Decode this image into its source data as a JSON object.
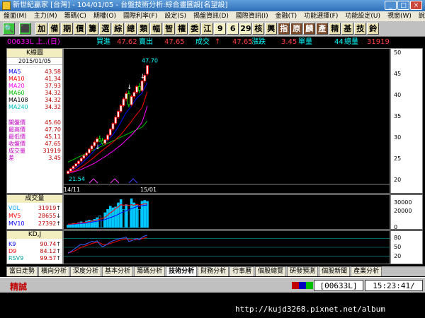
{
  "window": {
    "title": "新世紀贏家 [台灣] - 104/01/05 - 台盤技術分析:綜合畫圖設[名望設]",
    "btn_min": "_",
    "btn_max": "□",
    "btn_close": "×"
  },
  "menu": [
    "盤面(M)",
    "主力(M)",
    "籌碼(C)",
    "期權(O)",
    "國際利率(F)",
    "設定(S)",
    "揭盤資訊(D)",
    "國際資訊(I)",
    "金融(T)",
    "功能選擇(F)",
    "功能設定(U)",
    "視窗(W)",
    "說明(H)"
  ],
  "toolbar": {
    "green_icon_1": "🔍",
    "green_icon_2": "⬛",
    "buttons": [
      "加",
      "備",
      "期",
      "價",
      "籌",
      "選",
      "綜",
      "總",
      "類",
      "幅",
      "智",
      "權",
      "委",
      "江",
      "9",
      "6",
      "29",
      "核",
      "興",
      "指",
      "原",
      "麟",
      "產",
      "精",
      "基",
      "技",
      "鈴"
    ]
  },
  "quote": {
    "code": "00633L 上..(日)",
    "bid_label": "買進",
    "bid": "47.62",
    "ask_label": "賣出",
    "ask": "47.65",
    "last_label": "成交",
    "arrow": "↑",
    "change_label": "漲跌",
    "change": "47.65",
    "unit_label": "單量",
    "unit": "3.45",
    "total_label": "總量",
    "total_pre": "44",
    "total": "31919"
  },
  "left_panel": {
    "title": "K線圖",
    "date": "2015/01/05",
    "ma": [
      {
        "label": "MA5",
        "value": "43.58",
        "color": "#0000ff"
      },
      {
        "label": "MA10",
        "value": "41.34",
        "color": "#ff0000"
      },
      {
        "label": "MA20",
        "value": "37.93",
        "color": "#ff00ff"
      },
      {
        "label": "MA60",
        "value": "34.32",
        "color": "#00c000"
      },
      {
        "label": "MA108",
        "value": "34.32",
        "color": "#000000"
      },
      {
        "label": "MA240",
        "value": "34.32",
        "color": "#00c0c0"
      }
    ],
    "ohlc": [
      {
        "label": "開盤價",
        "value": "45.60"
      },
      {
        "label": "最高價",
        "value": "47.70"
      },
      {
        "label": "最低價",
        "value": "45.11"
      },
      {
        "label": "收盤價",
        "value": "47.65"
      },
      {
        "label": "成交量",
        "value": "31919"
      },
      {
        "label": "差",
        "value": "3.45"
      }
    ]
  },
  "main_chart": {
    "high_label": "47.70",
    "low_label": "21.54",
    "date_start": "14/11",
    "date_end": "15/01",
    "yticks": [
      "50",
      "45",
      "40",
      "35",
      "30",
      "25",
      "20"
    ],
    "ylim": [
      19,
      51
    ],
    "candles": [
      {
        "o": 21.6,
        "h": 22.4,
        "l": 21.54,
        "c": 22.2
      },
      {
        "o": 22.2,
        "h": 23.0,
        "l": 21.9,
        "c": 22.8
      },
      {
        "o": 22.8,
        "h": 23.6,
        "l": 22.5,
        "c": 23.4
      },
      {
        "o": 23.4,
        "h": 24.2,
        "l": 23.0,
        "c": 24.0
      },
      {
        "o": 24.0,
        "h": 24.9,
        "l": 23.7,
        "c": 24.6
      },
      {
        "o": 24.6,
        "h": 25.6,
        "l": 24.3,
        "c": 25.3
      },
      {
        "o": 25.3,
        "h": 26.2,
        "l": 25.0,
        "c": 26.0
      },
      {
        "o": 26.0,
        "h": 26.9,
        "l": 25.6,
        "c": 26.6
      },
      {
        "o": 26.6,
        "h": 27.8,
        "l": 26.3,
        "c": 27.5
      },
      {
        "o": 27.5,
        "h": 28.6,
        "l": 27.1,
        "c": 28.3
      },
      {
        "o": 28.3,
        "h": 29.6,
        "l": 27.9,
        "c": 29.2
      },
      {
        "o": 29.2,
        "h": 30.4,
        "l": 28.8,
        "c": 30.0
      },
      {
        "o": 30.0,
        "h": 30.8,
        "l": 29.2,
        "c": 29.5
      },
      {
        "o": 29.5,
        "h": 30.2,
        "l": 28.6,
        "c": 28.9
      },
      {
        "o": 28.9,
        "h": 30.1,
        "l": 28.5,
        "c": 29.8
      },
      {
        "o": 29.8,
        "h": 31.2,
        "l": 29.4,
        "c": 30.9
      },
      {
        "o": 30.9,
        "h": 32.6,
        "l": 30.5,
        "c": 32.3
      },
      {
        "o": 32.3,
        "h": 34.0,
        "l": 31.9,
        "c": 33.7
      },
      {
        "o": 33.7,
        "h": 35.6,
        "l": 33.3,
        "c": 35.2
      },
      {
        "o": 35.2,
        "h": 37.0,
        "l": 34.8,
        "c": 36.6
      },
      {
        "o": 36.6,
        "h": 38.4,
        "l": 36.2,
        "c": 38.0
      },
      {
        "o": 38.0,
        "h": 40.0,
        "l": 37.6,
        "c": 39.6
      },
      {
        "o": 39.6,
        "h": 41.4,
        "l": 39.0,
        "c": 40.9
      },
      {
        "o": 40.9,
        "h": 41.6,
        "l": 37.6,
        "c": 38.2
      },
      {
        "o": 38.2,
        "h": 40.6,
        "l": 37.8,
        "c": 40.2
      },
      {
        "o": 40.2,
        "h": 41.6,
        "l": 39.7,
        "c": 41.2
      },
      {
        "o": 41.2,
        "h": 43.0,
        "l": 40.8,
        "c": 42.6
      },
      {
        "o": 42.6,
        "h": 43.4,
        "l": 41.0,
        "c": 41.6
      },
      {
        "o": 41.6,
        "h": 44.2,
        "l": 41.3,
        "c": 43.9
      },
      {
        "o": 43.9,
        "h": 45.8,
        "l": 43.5,
        "c": 45.3
      },
      {
        "o": 45.6,
        "h": 47.7,
        "l": 45.11,
        "c": 47.65
      }
    ],
    "ma5": [
      21.8,
      22.2,
      22.6,
      23.0,
      23.5,
      24.0,
      24.6,
      25.2,
      25.8,
      26.5,
      27.2,
      27.9,
      28.5,
      28.9,
      29.3,
      29.8,
      30.3,
      31.0,
      31.9,
      32.9,
      34.0,
      35.2,
      36.3,
      37.1,
      37.9,
      38.9,
      39.8,
      40.4,
      41.0,
      42.3,
      43.58
    ],
    "ma10": [
      21.8,
      22.0,
      22.2,
      22.5,
      22.8,
      23.2,
      23.6,
      24.1,
      24.6,
      25.1,
      25.6,
      26.2,
      26.7,
      27.2,
      27.7,
      28.2,
      28.7,
      29.2,
      29.8,
      30.4,
      31.0,
      31.8,
      32.6,
      33.4,
      34.2,
      35.1,
      35.9,
      36.7,
      37.5,
      39.4,
      41.34
    ],
    "ma20": [
      21.8,
      21.9,
      22.0,
      22.2,
      22.4,
      22.6,
      22.9,
      23.2,
      23.5,
      23.8,
      24.1,
      24.5,
      24.9,
      25.3,
      25.7,
      26.1,
      26.6,
      27.0,
      27.5,
      28.0,
      28.5,
      29.1,
      29.7,
      30.3,
      30.9,
      31.6,
      32.3,
      33.1,
      34.0,
      35.9,
      37.93
    ],
    "ma60": [
      24.4,
      24.7,
      25.0,
      25.3,
      25.6,
      25.9,
      26.2,
      26.5,
      26.8,
      27.1,
      27.4,
      27.7,
      28.0,
      28.3,
      28.6,
      28.9,
      29.2,
      29.5,
      29.8,
      30.1,
      30.4,
      30.7,
      31.0,
      31.3,
      31.6,
      31.9,
      32.2,
      32.5,
      32.8,
      33.5,
      34.32
    ]
  },
  "volume": {
    "title": "成交量",
    "rows": [
      {
        "label": "VOL",
        "value": "31919",
        "arrow": "↑",
        "color": "#00a0ff"
      },
      {
        "label": "MV5",
        "value": "28655",
        "arrow": "↓",
        "color": "#ff0000"
      },
      {
        "label": "MV10",
        "value": "27392",
        "arrow": "↑",
        "color": "#0000ff"
      }
    ],
    "yticks": [
      "30000",
      "20000",
      "0"
    ],
    "ylim": [
      0,
      36000
    ],
    "values": [
      3000,
      4000,
      5000,
      4500,
      6000,
      7000,
      5500,
      8000,
      9000,
      8500,
      10000,
      12000,
      14000,
      9000,
      18000,
      22000,
      26000,
      24000,
      25000,
      30000,
      34000,
      22000,
      28000,
      20000,
      35000,
      30000,
      27000,
      22000,
      32000,
      33000,
      31919
    ],
    "colors": [
      "w",
      "w",
      "w",
      "w",
      "w",
      "w",
      "w",
      "w",
      "w",
      "w",
      "w",
      "w",
      "k",
      "k",
      "w",
      "w",
      "w",
      "w",
      "w",
      "w",
      "w",
      "k",
      "w",
      "k",
      "w",
      "w",
      "w",
      "k",
      "w",
      "w",
      "w"
    ],
    "mv5": [
      4000,
      4200,
      4500,
      4800,
      5200,
      5600,
      6000,
      6600,
      7200,
      7800,
      8500,
      9300,
      10200,
      11000,
      12600,
      15000,
      17800,
      20000,
      23000,
      25000,
      27800,
      27000,
      27600,
      26700,
      27800,
      27000,
      28400,
      26800,
      28100,
      28700,
      28655
    ],
    "mv10": [
      4000,
      4100,
      4200,
      4400,
      4600,
      4900,
      5200,
      5600,
      6000,
      6500,
      7000,
      7600,
      8300,
      9000,
      9800,
      10800,
      12000,
      13200,
      14500,
      16000,
      17700,
      19000,
      20300,
      21600,
      22900,
      24100,
      25300,
      26000,
      26600,
      27000,
      27392
    ]
  },
  "kd": {
    "title": "KD,J",
    "rows": [
      {
        "label": "K9",
        "value": "90.74",
        "arrow": "↑",
        "color": "#0000ff"
      },
      {
        "label": "D9",
        "value": "84.12",
        "arrow": "↑",
        "color": "#ff0000"
      },
      {
        "label": "RSV9",
        "value": "99.57",
        "arrow": "↑",
        "color": "#00a0a0"
      }
    ],
    "yticks": [
      "80",
      "50",
      "20"
    ],
    "ylim": [
      0,
      100
    ],
    "k": [
      30,
      35,
      42,
      48,
      55,
      60,
      58,
      62,
      66,
      70,
      68,
      72,
      60,
      52,
      56,
      62,
      68,
      72,
      75,
      78,
      80,
      82,
      84,
      70,
      72,
      76,
      80,
      76,
      84,
      88,
      90.74
    ],
    "d": [
      32,
      33,
      36,
      40,
      45,
      50,
      53,
      56,
      59,
      63,
      65,
      67,
      65,
      61,
      59,
      60,
      63,
      66,
      69,
      72,
      75,
      77,
      79,
      76,
      75,
      75,
      77,
      77,
      79,
      82,
      84.12
    ]
  },
  "tabs": [
    {
      "label": "當日走勢",
      "active": false
    },
    {
      "label": "橫向分析",
      "active": false
    },
    {
      "label": "深度分析",
      "active": false
    },
    {
      "label": "基本分析",
      "active": false
    },
    {
      "label": "籌碼分析",
      "active": false
    },
    {
      "label": "技術分析",
      "active": true
    },
    {
      "label": "財務分析",
      "active": false
    },
    {
      "label": "行事曆",
      "active": false
    },
    {
      "label": "個股總覽",
      "active": false
    },
    {
      "label": "研發預測",
      "active": false
    },
    {
      "label": "個股新聞",
      "active": false
    },
    {
      "label": "產業分析",
      "active": false
    }
  ],
  "status": {
    "brand": "精誠",
    "colors": [
      "#c00000",
      "#0000c0",
      "#00c000"
    ],
    "code": "[00633L]",
    "time": "15:23:41/"
  },
  "watermark": "http://kujd3268.pixnet.net/album",
  "colors": {
    "up": "#ff0000",
    "down": "#00ff00",
    "candle_up_fill": "#ffffff",
    "candle_down_fill": "#000000",
    "ma5": "#0000ff",
    "ma10": "#ff0000",
    "ma20": "#ff00ff",
    "ma60": "#00c000"
  }
}
